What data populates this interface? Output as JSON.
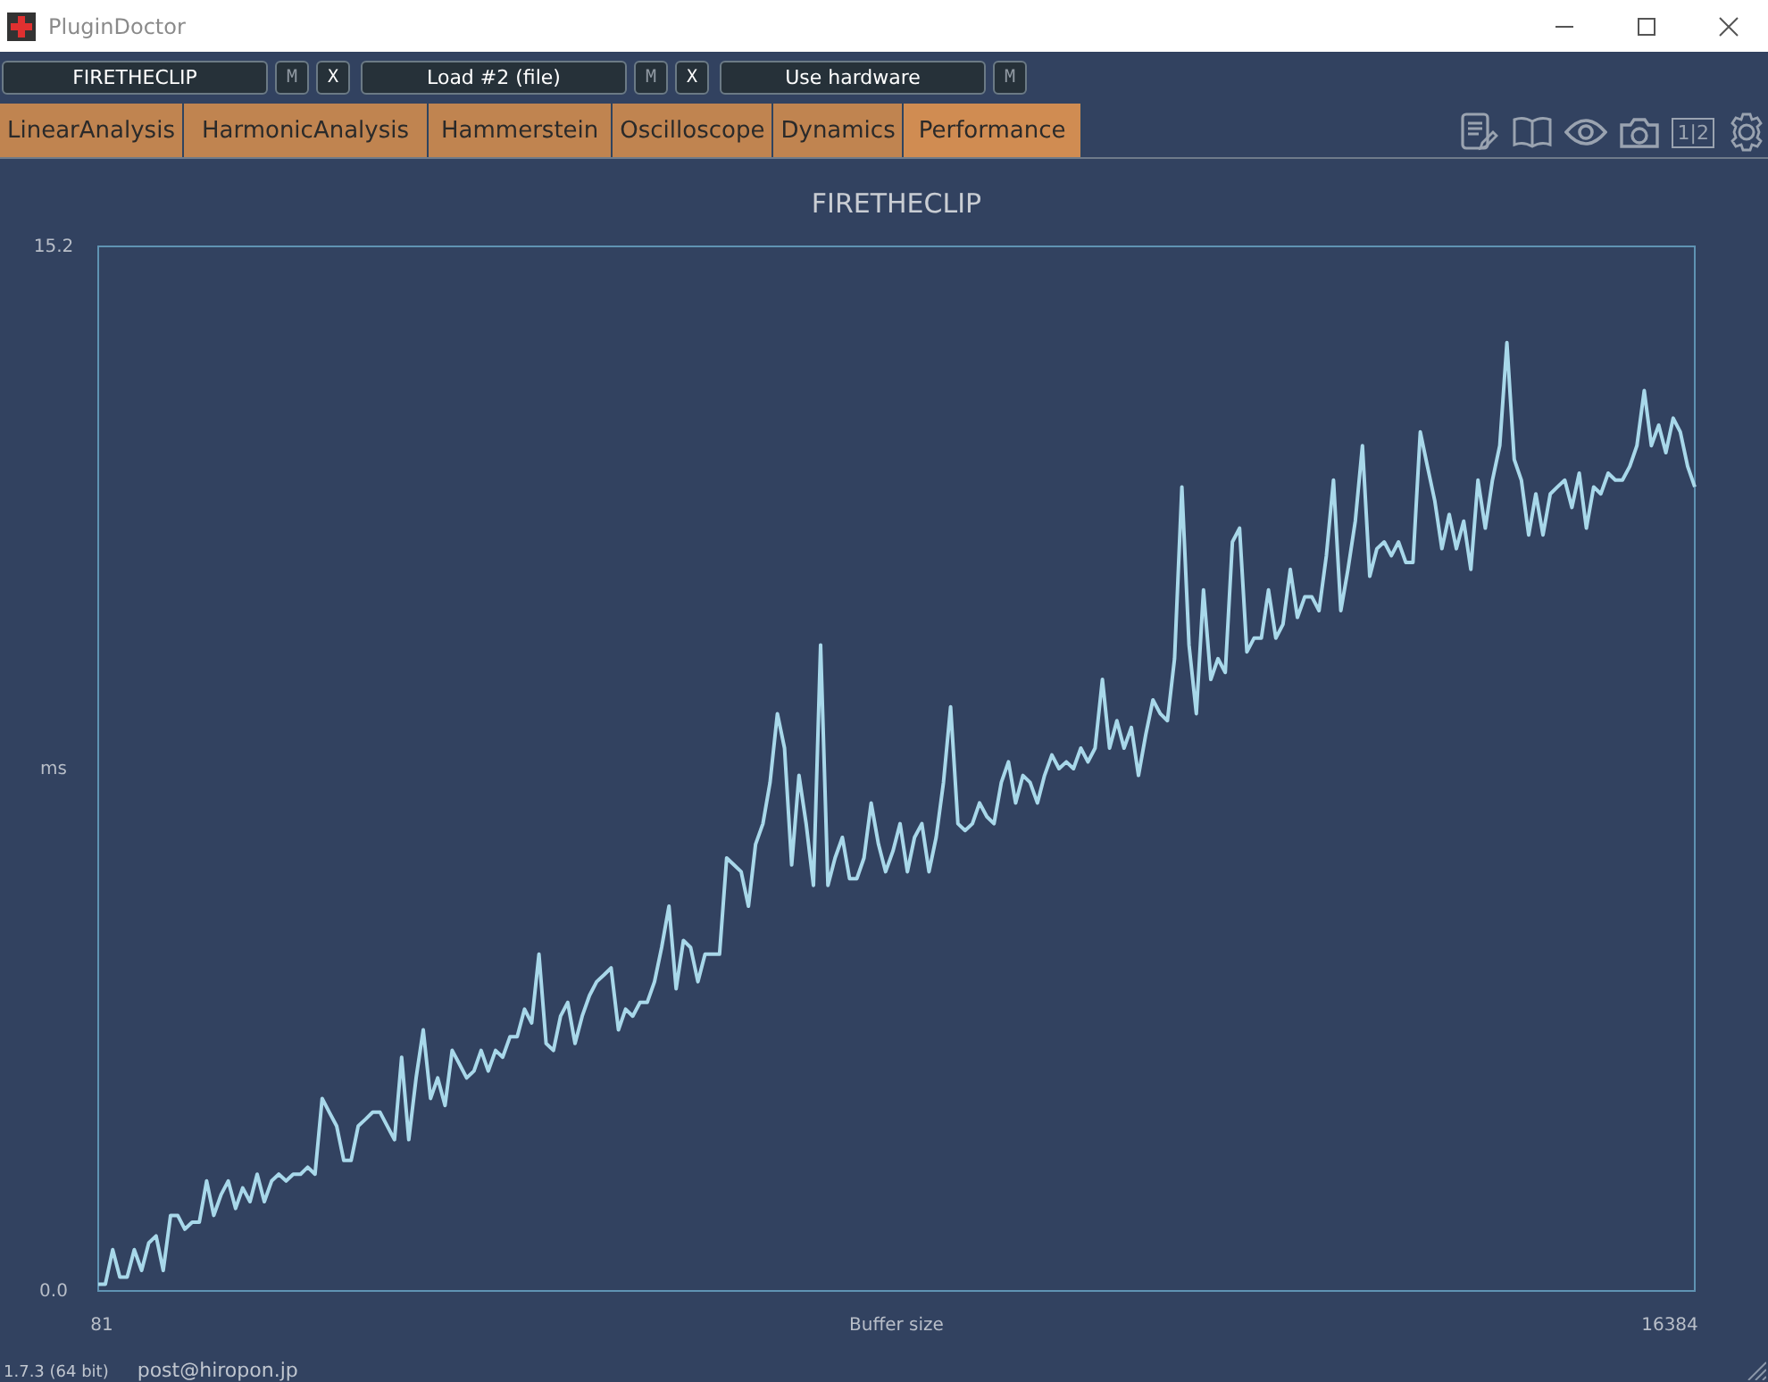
{
  "window": {
    "title": "PluginDoctor"
  },
  "toolbar": [
    {
      "label": "FIRETHECLIP",
      "buttons": [
        {
          "label": "M",
          "disabled": true
        },
        {
          "label": "X",
          "disabled": false
        }
      ]
    },
    {
      "label": "Load #2 (file)",
      "buttons": [
        {
          "label": "M",
          "disabled": true
        },
        {
          "label": "X",
          "disabled": false
        }
      ]
    },
    {
      "label": "Use hardware",
      "buttons": [
        {
          "label": "M",
          "disabled": true
        }
      ]
    }
  ],
  "tabs": [
    {
      "label": "LinearAnalysis",
      "selected": false
    },
    {
      "label": "HarmonicAnalysis",
      "selected": false
    },
    {
      "label": "Hammerstein",
      "selected": false
    },
    {
      "label": "Oscilloscope",
      "selected": false
    },
    {
      "label": "Dynamics",
      "selected": false
    },
    {
      "label": "Performance",
      "selected": true
    }
  ],
  "tools": [
    {
      "kind": "notes"
    },
    {
      "kind": "book"
    },
    {
      "kind": "eye"
    },
    {
      "kind": "camera"
    },
    {
      "kind": "split",
      "label": "1|2"
    },
    {
      "kind": "gear"
    }
  ],
  "chart": {
    "chart_data": {
      "type": "line",
      "title": "FIRETHECLIP",
      "xlabel": "Buffer size",
      "ylabel": "ms",
      "ylim": [
        0,
        15.2
      ],
      "yticks": [
        {
          "value": 0,
          "label": "0.0"
        },
        {
          "value": 15.2,
          "label": "15.2"
        }
      ],
      "series": [
        {
          "color": "#a8d8ea",
          "values": [
            0.1,
            0.1,
            0.6,
            0.2,
            0.2,
            0.6,
            0.3,
            0.7,
            0.8,
            0.3,
            1.1,
            1.1,
            0.9,
            1.0,
            1.0,
            1.6,
            1.1,
            1.4,
            1.6,
            1.2,
            1.5,
            1.3,
            1.7,
            1.3,
            1.6,
            1.7,
            1.6,
            1.7,
            1.7,
            1.8,
            1.7,
            2.8,
            2.6,
            2.4,
            1.9,
            1.9,
            2.4,
            2.5,
            2.6,
            2.6,
            2.4,
            2.2,
            3.4,
            2.2,
            3.1,
            3.8,
            2.8,
            3.1,
            2.7,
            3.5,
            3.3,
            3.1,
            3.2,
            3.5,
            3.2,
            3.5,
            3.4,
            3.7,
            3.7,
            4.1,
            3.9,
            4.9,
            3.6,
            3.5,
            4.0,
            4.2,
            3.6,
            4.0,
            4.3,
            4.5,
            4.6,
            4.7,
            3.8,
            4.1,
            4.0,
            4.2,
            4.2,
            4.5,
            5.0,
            5.6,
            4.4,
            5.1,
            5.0,
            4.5,
            4.9,
            4.9,
            4.9,
            6.3,
            6.2,
            6.1,
            5.6,
            6.5,
            6.8,
            7.4,
            8.4,
            7.9,
            6.2,
            7.5,
            6.8,
            5.9,
            9.4,
            5.9,
            6.3,
            6.6,
            6.0,
            6.0,
            6.3,
            7.1,
            6.5,
            6.1,
            6.4,
            6.8,
            6.1,
            6.6,
            6.8,
            6.1,
            6.6,
            7.4,
            8.5,
            6.8,
            6.7,
            6.8,
            7.1,
            6.9,
            6.8,
            7.4,
            7.7,
            7.1,
            7.5,
            7.4,
            7.1,
            7.5,
            7.8,
            7.6,
            7.7,
            7.6,
            7.9,
            7.7,
            7.9,
            8.9,
            7.9,
            8.3,
            7.9,
            8.2,
            7.5,
            8.1,
            8.6,
            8.4,
            8.3,
            9.2,
            11.7,
            9.4,
            8.4,
            10.2,
            8.9,
            9.2,
            9.0,
            10.9,
            11.1,
            9.3,
            9.5,
            9.5,
            10.2,
            9.5,
            9.7,
            10.5,
            9.8,
            10.1,
            10.1,
            9.9,
            10.7,
            11.8,
            9.9,
            10.5,
            11.2,
            12.3,
            10.4,
            10.8,
            10.9,
            10.7,
            10.9,
            10.6,
            10.6,
            12.5,
            12.0,
            11.5,
            10.8,
            11.3,
            10.8,
            11.2,
            10.5,
            11.8,
            11.1,
            11.8,
            12.3,
            13.8,
            12.1,
            11.8,
            11.0,
            11.6,
            11.0,
            11.6,
            11.7,
            11.8,
            11.4,
            11.9,
            11.1,
            11.7,
            11.6,
            11.9,
            11.8,
            11.8,
            12.0,
            12.3,
            13.1,
            12.3,
            12.6,
            12.2,
            12.7,
            12.5,
            12.0,
            11.7
          ]
        }
      ]
    },
    "x_start_label": "81",
    "x_end_label": "16384"
  },
  "status_bar": {
    "version": "1.7.3 (64 bit)",
    "contact": "post@hiropon.jp"
  }
}
